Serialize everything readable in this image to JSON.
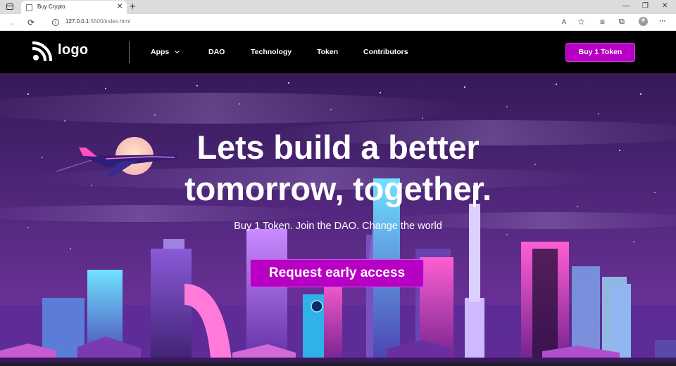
{
  "browser": {
    "tab_title": "Buy Crypto",
    "tab_close_glyph": "✕",
    "new_tab_glyph": "+",
    "window_controls": [
      "—",
      "❐",
      "✕"
    ],
    "back_glyph": "←",
    "reload_glyph": "⟳",
    "info_glyph": "i",
    "url_host": "127.0.0.1",
    "url_path": ":5500/index.html",
    "toolbar_icons": [
      "read-aloud-icon",
      "favorite-add-icon",
      "favorites-icon",
      "collections-icon",
      "profile-icon",
      "more-icon"
    ],
    "read_aloud_glyph": "A",
    "favorite_glyph": "☆",
    "favorites_glyph": "≡",
    "collections_glyph": "⧉",
    "more_glyph": "···"
  },
  "site": {
    "logo_text": "logo",
    "nav": {
      "apps": "Apps",
      "dao": "DAO",
      "technology": "Technology",
      "token": "Token",
      "contributors": "Contributors"
    },
    "buy_button": "Buy 1 Token"
  },
  "hero": {
    "title_line1": "Lets build a better",
    "title_line2": "tomorrow, together.",
    "subtitle": "Buy 1 Token. Join the DAO. Change the world",
    "cta": "Request early access"
  },
  "colors": {
    "brand_magenta": "#b800c4",
    "nav_bg": "#000000",
    "hero_sky_top": "#351a57",
    "hero_sky_bottom": "#7a35a8"
  }
}
